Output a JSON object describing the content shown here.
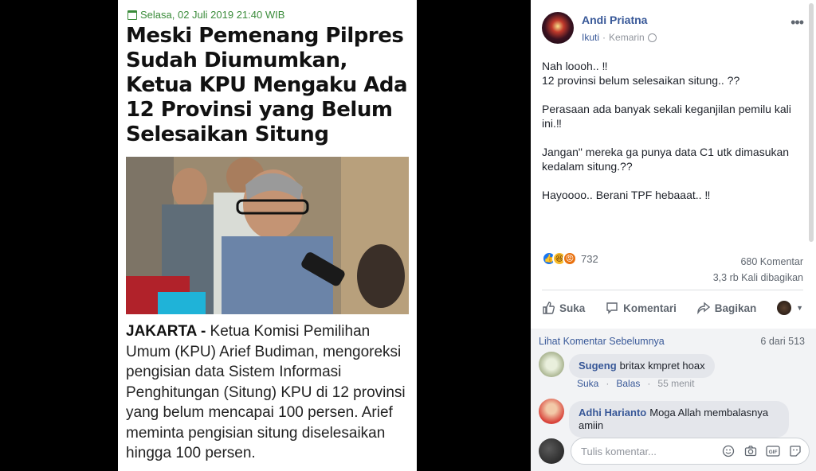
{
  "article": {
    "date": "Selasa, 02 Juli 2019 21:40 WIB",
    "title": "Meski Pemenang Pilpres Sudah Diumumkan, Ketua KPU Mengaku Ada 12 Provinsi yang Belum Selesaikan Situng",
    "lead": "JAKARTA -",
    "body": " Ketua Komisi Pemilihan Umum (KPU) Arief Budiman, mengoreksi pengisian data Sistem Informasi Penghitungan (Situng) KPU di 12 provinsi yang belum mencapai 100 persen. Arief meminta pengisian situng diselesaikan hingga 100 persen."
  },
  "post": {
    "author": "Andi Priatna",
    "follow": "Ikuti",
    "separator": "·",
    "time": "Kemarin",
    "more": "•••",
    "paragraphs": [
      "Nah loooh.. ‼\n12 provinsi belum selesaikan situng.. ??",
      "Perasaan ada banyak sekali keganjilan pemilu kali ini.‼",
      "Jangan\" mereka ga punya data C1 utk dimasukan kedalam situng.??",
      "Hayoooo.. Berani TPF hebaaat.. ‼"
    ]
  },
  "reactions": {
    "count": "732",
    "comments": "680 Komentar",
    "shares": "3,3 rb Kali dibagikan"
  },
  "actions": {
    "like": "Suka",
    "comment": "Komentari",
    "share": "Bagikan"
  },
  "comments": {
    "prev_label": "Lihat Komentar Sebelumnya",
    "count": "6 dari 513",
    "items": [
      {
        "name": "Sugeng",
        "text": "britax kmpret hoax",
        "like": "Suka",
        "reply": "Balas",
        "time": "55 menit"
      },
      {
        "name": "Adhi Harianto",
        "text": "Moga Allah membalasnya amiin"
      }
    ],
    "composer_placeholder": "Tulis komentar..."
  },
  "colors": {
    "link": "#385898",
    "muted": "#606770",
    "date_green": "#3b8c3b"
  }
}
